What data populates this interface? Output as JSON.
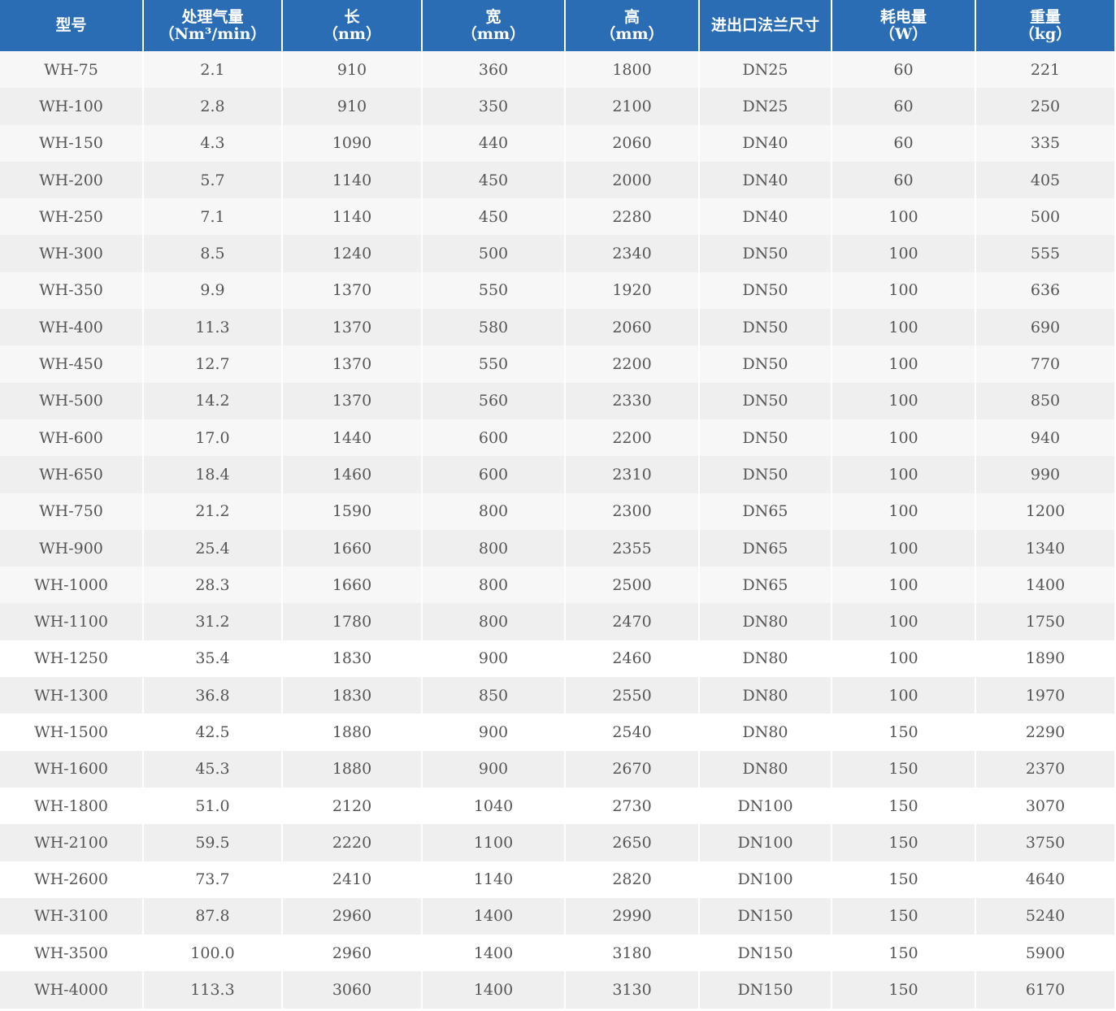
{
  "table": {
    "headers": [
      {
        "lines": [
          "型号"
        ]
      },
      {
        "lines": [
          "处理气量",
          "（Nm³/min）"
        ]
      },
      {
        "lines": [
          "长",
          "（nm）"
        ]
      },
      {
        "lines": [
          "宽",
          "（mm）"
        ]
      },
      {
        "lines": [
          "高",
          "（mm）"
        ]
      },
      {
        "lines": [
          "进出口法兰尺寸"
        ]
      },
      {
        "lines": [
          "耗电量",
          "（W）"
        ]
      },
      {
        "lines": [
          "重量",
          "（kg）"
        ]
      }
    ],
    "rows": [
      [
        "WH-75",
        "2.1",
        "910",
        "360",
        "1800",
        "DN25",
        "60",
        "221"
      ],
      [
        "WH-100",
        "2.8",
        "910",
        "350",
        "2100",
        "DN25",
        "60",
        "250"
      ],
      [
        "WH-150",
        "4.3",
        "1090",
        "440",
        "2060",
        "DN40",
        "60",
        "335"
      ],
      [
        "WH-200",
        "5.7",
        "1140",
        "450",
        "2000",
        "DN40",
        "60",
        "405"
      ],
      [
        "WH-250",
        "7.1",
        "1140",
        "450",
        "2280",
        "DN40",
        "100",
        "500"
      ],
      [
        "WH-300",
        "8.5",
        "1240",
        "500",
        "2340",
        "DN50",
        "100",
        "555"
      ],
      [
        "WH-350",
        "9.9",
        "1370",
        "550",
        "1920",
        "DN50",
        "100",
        "636"
      ],
      [
        "WH-400",
        "11.3",
        "1370",
        "580",
        "2060",
        "DN50",
        "100",
        "690"
      ],
      [
        "WH-450",
        "12.7",
        "1370",
        "550",
        "2200",
        "DN50",
        "100",
        "770"
      ],
      [
        "WH-500",
        "14.2",
        "1370",
        "560",
        "2330",
        "DN50",
        "100",
        "850"
      ],
      [
        "WH-600",
        "17.0",
        "1440",
        "600",
        "2200",
        "DN50",
        "100",
        "940"
      ],
      [
        "WH-650",
        "18.4",
        "1460",
        "600",
        "2310",
        "DN50",
        "100",
        "990"
      ],
      [
        "WH-750",
        "21.2",
        "1590",
        "800",
        "2300",
        "DN65",
        "100",
        "1200"
      ],
      [
        "WH-900",
        "25.4",
        "1660",
        "800",
        "2355",
        "DN65",
        "100",
        "1340"
      ],
      [
        "WH-1000",
        "28.3",
        "1660",
        "800",
        "2500",
        "DN65",
        "100",
        "1400"
      ],
      [
        "WH-1100",
        "31.2",
        "1780",
        "800",
        "2470",
        "DN80",
        "100",
        "1750"
      ],
      [
        "WH-1250",
        "35.4",
        "1830",
        "900",
        "2460",
        "DN80",
        "100",
        "1890"
      ],
      [
        "WH-1300",
        "36.8",
        "1830",
        "850",
        "2550",
        "DN80",
        "100",
        "1970"
      ],
      [
        "WH-1500",
        "42.5",
        "1880",
        "900",
        "2540",
        "DN80",
        "150",
        "2290"
      ],
      [
        "WH-1600",
        "45.3",
        "1880",
        "900",
        "2670",
        "DN80",
        "150",
        "2370"
      ],
      [
        "WH-1800",
        "51.0",
        "2120",
        "1040",
        "2730",
        "DN100",
        "150",
        "3070"
      ],
      [
        "WH-2100",
        "59.5",
        "2220",
        "1100",
        "2650",
        "DN100",
        "150",
        "3750"
      ],
      [
        "WH-2600",
        "73.7",
        "2410",
        "1140",
        "2820",
        "DN100",
        "150",
        "4640"
      ],
      [
        "WH-3100",
        "87.8",
        "2960",
        "1400",
        "2990",
        "DN150",
        "150",
        "5240"
      ],
      [
        "WH-3500",
        "100.0",
        "2960",
        "1400",
        "3180",
        "DN150",
        "150",
        "5900"
      ],
      [
        "WH-4000",
        "113.3",
        "3060",
        "1400",
        "3130",
        "DN150",
        "150",
        "6170"
      ]
    ]
  },
  "colors": {
    "header_background": "#2a6db5",
    "header_text": "#ffffff",
    "row_light": "#f7f7f7",
    "row_alt": "#efefef",
    "body_text": "#555555"
  }
}
